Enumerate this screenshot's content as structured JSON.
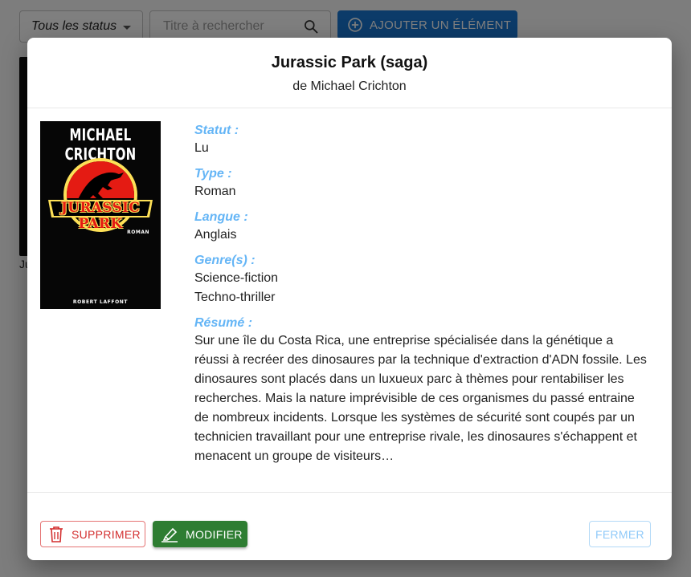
{
  "toolbar": {
    "status_filter": "Tous les status",
    "search_placeholder": "Titre à rechercher",
    "add_label": "Ajouter un élément"
  },
  "background": {
    "card_title": "Ju"
  },
  "modal": {
    "title": "Jurassic Park (saga)",
    "subtitle": "de Michael Crichton",
    "cover": {
      "author": "MICHAEL CRICHTON",
      "logo_text": "JURASSIC PARK",
      "genre": "ROMAN",
      "publisher": "ROBERT LAFFONT"
    },
    "fields": {
      "status": {
        "label": "Statut :",
        "value": "Lu"
      },
      "type": {
        "label": "Type :",
        "value": "Roman"
      },
      "language": {
        "label": "Langue :",
        "value": "Anglais"
      },
      "genres": {
        "label": "Genre(s) :",
        "values": [
          "Science-fiction",
          "Techno-thriller"
        ]
      },
      "summary": {
        "label": "Résumé :",
        "lines": [
          "Sur une île du Costa Rica, une entreprise spécialisée dans la génétique a",
          "réussi à recréer des dinosaures par la technique d'extraction d'ADN fossile. Les",
          "dinosaures sont placés dans un luxueux parc à thèmes pour rentabiliser les",
          "recherches. Mais la nature imprévisible de ces organismes du passé entraine",
          "de nombreux incidents. Lorsque les systèmes de sécurité sont coupés par un",
          "technicien travaillant pour une entreprise rivale, les dinosaures s'échappent et",
          "menacent un groupe de visiteurs…"
        ]
      }
    },
    "actions": {
      "delete_label": "Supprimer",
      "edit_label": "Modifier",
      "close_label": "Fermer"
    }
  },
  "colors": {
    "primary": "#1976d2",
    "field_label": "#64b5f6",
    "delete": "#d32f2f",
    "edit": "#2e7d32",
    "close": "#90caf9"
  },
  "icons": {
    "search": "search-icon",
    "add": "plus-circle-icon",
    "delete": "trash-icon",
    "edit": "highlighter-icon",
    "caret": "caret-down-icon"
  }
}
